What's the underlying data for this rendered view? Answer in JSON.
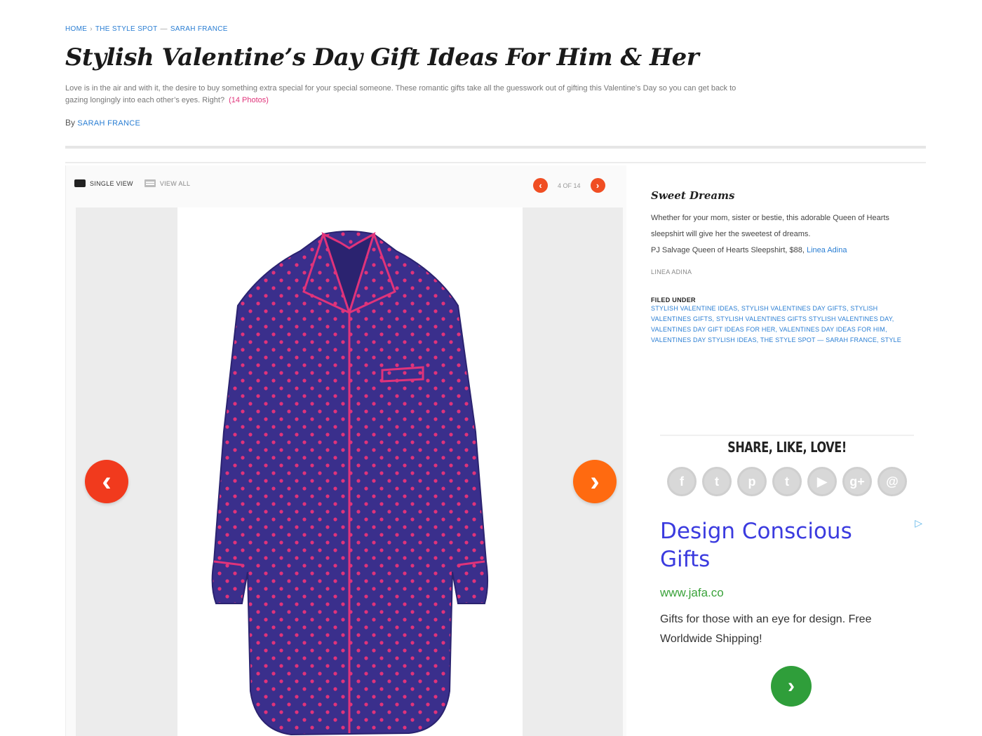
{
  "breadcrumb": {
    "items": [
      "HOME",
      "THE STYLE SPOT",
      "SARAH FRANCE"
    ]
  },
  "article": {
    "title": "Stylish Valentine’s Day Gift Ideas For Him & Her",
    "deck": "Love is in the air and with it, the desire to buy something extra special for your special someone. These romantic gifts take all the guesswork out of gifting this Valentine’s Day so you can get back to gazing longingly into each other’s eyes. Right?",
    "photos_link": "(14 Photos)",
    "by_prefix": "By",
    "author": "SARAH FRANCE"
  },
  "gallery": {
    "view_single": "SINGLE VIEW",
    "view_grid": "VIEW ALL",
    "counter": "4 OF 14",
    "prev_label": "‹",
    "next_label": "›"
  },
  "slide": {
    "title": "Sweet Dreams",
    "text": "Whether for your mom, sister or bestie, this adorable Queen of Hearts sleepshirt will give her the sweetest of dreams.",
    "price_line": "PJ Salvage Queen of Hearts Sleepshirt, $88,",
    "retailer": "Linea Adina",
    "credit": "LINEA ADINA",
    "filed_label": "FILED UNDER",
    "filed_tags": "STYLISH VALENTINE IDEAS, STYLISH VALENTINES DAY GIFTS, STYLISH VALENTINES GIFTS, STYLISH VALENTINES GIFTS STYLISH VALENTINES DAY, VALENTINES DAY GIFT IDEAS FOR HER, VALENTINES DAY IDEAS FOR HIM, VALENTINES DAY STYLISH IDEAS, THE STYLE SPOT — SARAH FRANCE, STYLE"
  },
  "share": {
    "title": "SHARE, LIKE, LOVE!",
    "icons": [
      {
        "name": "facebook-icon",
        "glyph": "f"
      },
      {
        "name": "twitter-icon",
        "glyph": "t"
      },
      {
        "name": "pinterest-icon",
        "glyph": "p"
      },
      {
        "name": "tumblr-icon",
        "glyph": "t"
      },
      {
        "name": "youtube-icon",
        "glyph": "▶"
      },
      {
        "name": "googleplus-icon",
        "glyph": "g+"
      },
      {
        "name": "email-icon",
        "glyph": "@"
      }
    ]
  },
  "ad": {
    "title": "Design Conscious Gifts",
    "url": "www.jafa.co",
    "body": "Gifts for those with an eye for design. Free Worldwide Shipping!",
    "marker": "▷",
    "go_label": "›"
  },
  "colors": {
    "link": "#2a7ed3",
    "accent_pink": "#e0337a",
    "nav_prev": "#f13a1d",
    "nav_next": "#ff6a10",
    "ad_title": "#3b3bdf",
    "ad_url": "#3aa23a",
    "shirt": "#3a2f8c",
    "dots": "#e0337a"
  }
}
